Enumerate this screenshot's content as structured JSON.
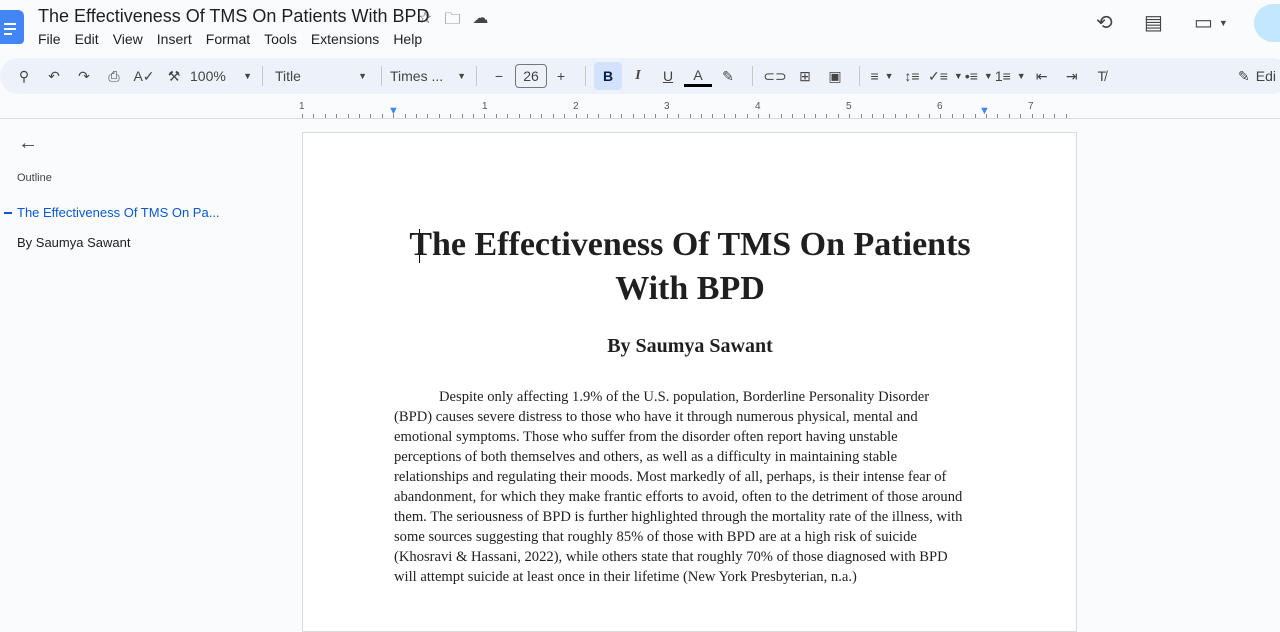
{
  "doc_title": "The Effectiveness Of TMS On Patients With BPD",
  "menu": [
    "File",
    "Edit",
    "View",
    "Insert",
    "Format",
    "Tools",
    "Extensions",
    "Help"
  ],
  "toolbar": {
    "zoom": "100%",
    "style": "Title",
    "font": "Times ...",
    "font_size": "26",
    "edit_mode": "Edi"
  },
  "ruler": [
    "1",
    "1",
    "2",
    "3",
    "4",
    "5",
    "6",
    "7"
  ],
  "outline": {
    "label": "Outline",
    "items": [
      "The Effectiveness Of TMS On Pa...",
      "By Saumya Sawant"
    ]
  },
  "document": {
    "title": "The Effectiveness Of TMS On Patients With BPD",
    "author": "By Saumya Sawant",
    "paragraph_lines": [
      "Despite only affecting 1.9% of the U.S. population, Borderline Personality Disorder",
      "(BPD) causes severe distress to those who have it through numerous physical, mental and",
      "emotional symptoms. Those who suffer from the disorder often report having unstable",
      "perceptions of both themselves and others, as well as a difficulty in maintaining stable",
      "relationships and regulating their moods. Most markedly of all, perhaps, is their intense fear of",
      "abandonment, for which they make frantic efforts to avoid, often to the detriment of those around",
      "them. The seriousness of BPD is further highlighted through the mortality rate of the illness, with",
      "some sources suggesting that roughly 85% of those with BPD are at a high risk of suicide",
      "(Khosravi & Hassani, 2022), while others state that roughly 70% of those diagnosed with BPD",
      "will attempt suicide at least once in their lifetime (New York Presbyterian, n.a.)"
    ]
  }
}
